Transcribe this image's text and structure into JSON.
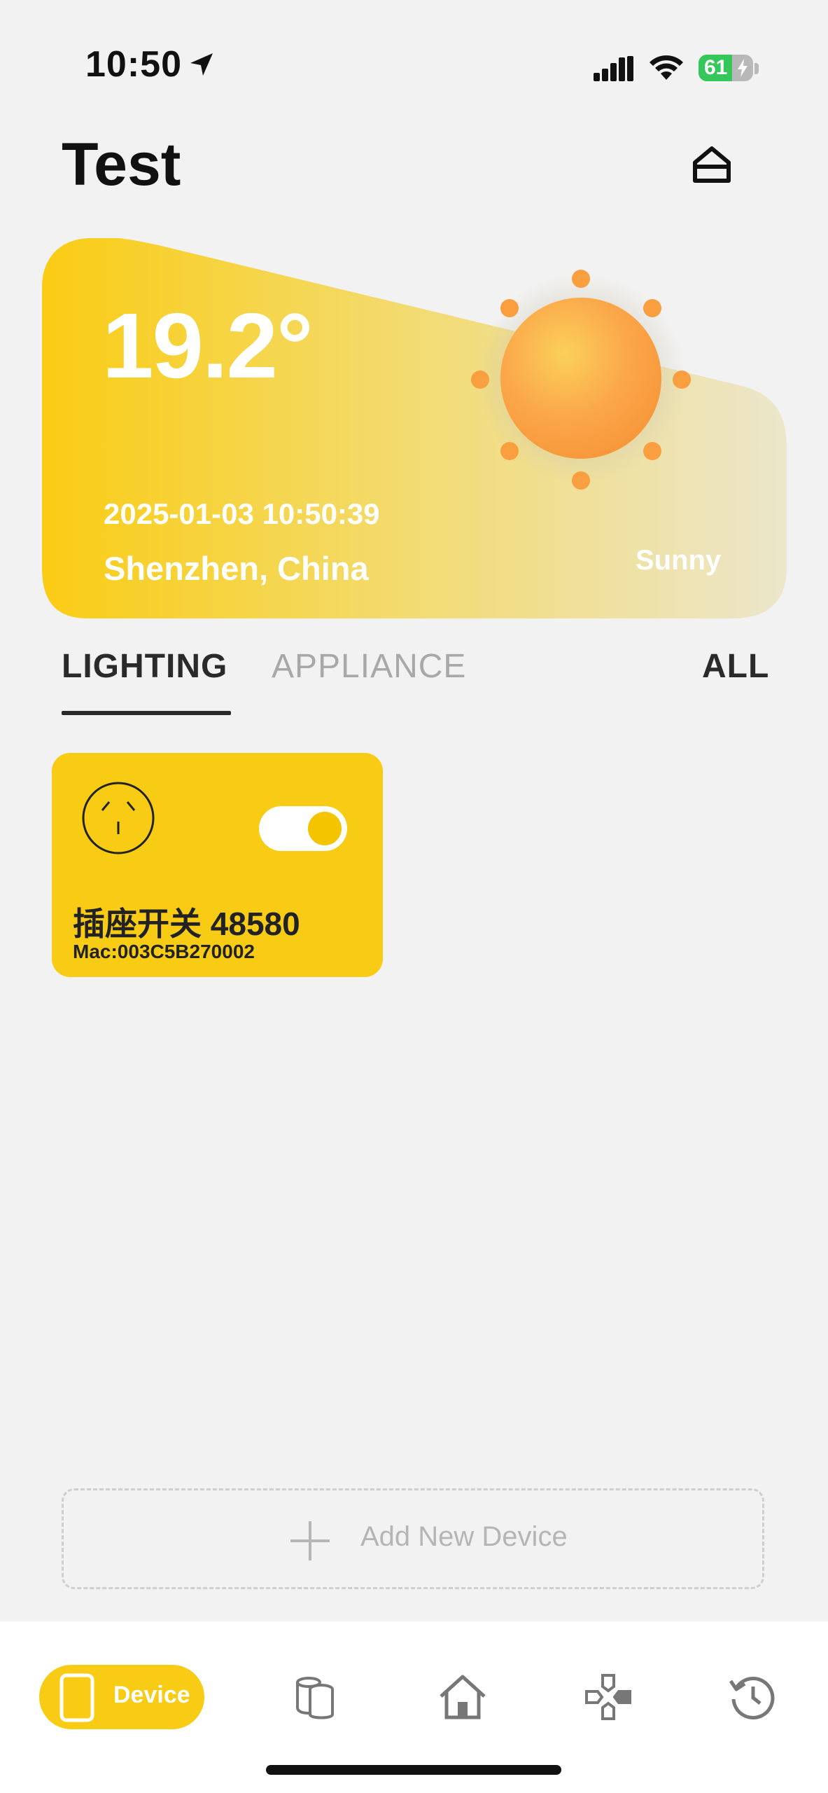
{
  "status_bar": {
    "time": "10:50",
    "battery": "61",
    "battery_level": 0.61
  },
  "header": {
    "title": "Test"
  },
  "weather": {
    "temperature": "19.2°",
    "datetime": "2025-01-03 10:50:39",
    "location": "Shenzhen, China",
    "condition": "Sunny"
  },
  "tabs": [
    {
      "label": "LIGHTING",
      "active": true
    },
    {
      "label": "APPLIANCE",
      "active": false
    }
  ],
  "tab_all": "ALL",
  "devices": [
    {
      "name": "插座开关 48580",
      "mac": "Mac:003C5B270002",
      "icon": "power-socket-icon",
      "on": true
    }
  ],
  "add_device": {
    "label": "Add New Device"
  },
  "bottom_nav": {
    "items": [
      {
        "label": "Device",
        "icon": "phone-device-icon",
        "active": true
      },
      {
        "label": "",
        "icon": "cylinders-icon"
      },
      {
        "label": "",
        "icon": "house-icon"
      },
      {
        "label": "",
        "icon": "gamepad-icon"
      },
      {
        "label": "",
        "icon": "history-icon"
      }
    ]
  },
  "colors": {
    "accent": "#f8cc14",
    "background": "#f2f2f2",
    "sun": "#fb9f3e"
  }
}
